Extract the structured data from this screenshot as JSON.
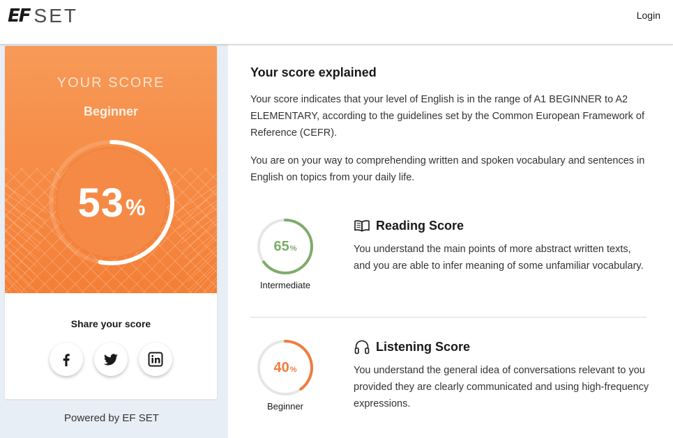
{
  "header": {
    "logo_ef": "EF",
    "logo_set": "SET",
    "login_label": "Login"
  },
  "score_card": {
    "heading": "YOUR SCORE",
    "level": "Beginner",
    "percent": 53,
    "percent_text": "53",
    "percent_symbol": "%",
    "share_title": "Share your score",
    "share_buttons": [
      {
        "icon": "facebook-icon"
      },
      {
        "icon": "twitter-icon"
      },
      {
        "icon": "linkedin-icon"
      }
    ],
    "powered_by": "Powered by EF SET"
  },
  "explanation": {
    "title": "Your score explained",
    "paragraph1": "Your score indicates that your level of English is in the range of A1 BEGINNER to A2 ELEMENTARY, according to the guidelines set by the Common European Framework of Reference (CEFR).",
    "paragraph2": "You are on your way to comprehending written and spoken vocabulary and sentences in English on topics from your daily life."
  },
  "skills": [
    {
      "name": "Reading Score",
      "icon": "book-icon",
      "percent": 65,
      "percent_text": "65",
      "percent_symbol": "%",
      "level": "Intermediate",
      "color": "#7fac6a",
      "description": "You understand the main points of more abstract written texts, and you are able to infer meaning of some unfamiliar vocabulary."
    },
    {
      "name": "Listening Score",
      "icon": "headphones-icon",
      "percent": 40,
      "percent_text": "40",
      "percent_symbol": "%",
      "level": "Beginner",
      "color": "#f07d3e",
      "description": "You understand the general idea of conversations relevant to you provided they are clearly communicated and using high-frequency expressions."
    }
  ],
  "colors": {
    "accent_orange": "#f68a44",
    "reading_green": "#7fac6a",
    "listening_orange": "#f07d3e",
    "ring_track": "#e6e6e6"
  }
}
